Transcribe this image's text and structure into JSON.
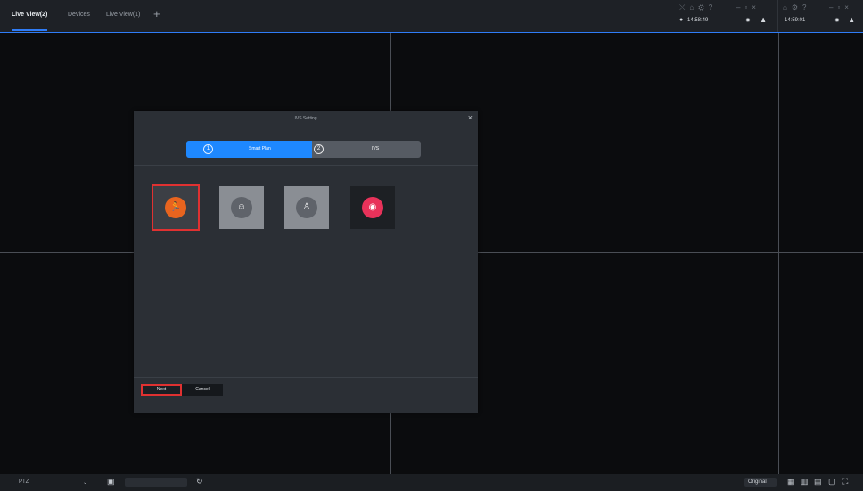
{
  "tabs": [
    {
      "label": "Live View(2)",
      "active": true
    },
    {
      "label": "Devices",
      "active": false
    },
    {
      "label": "Live View(1)",
      "active": false
    }
  ],
  "add_tab_icon": "plus-icon",
  "status": {
    "clock1": "14:58:49",
    "clock2": "14:59:01"
  },
  "dialog": {
    "title": "IVS Setting",
    "steps": [
      {
        "number": "1",
        "label": "Smart Plan"
      },
      {
        "number": "2",
        "label": "IVS"
      }
    ],
    "plans": [
      {
        "icon": "intrusion-person-icon",
        "color": "#e8641f",
        "selected": true
      },
      {
        "icon": "face-detection-icon",
        "color": "#7a7e84",
        "selected": false
      },
      {
        "icon": "people-counting-icon",
        "color": "#7a7e84",
        "selected": false
      },
      {
        "icon": "heat-map-icon",
        "color": "#e8325a",
        "selected": false
      }
    ],
    "next_label": "Next",
    "cancel_label": "Cancel"
  },
  "bottom": {
    "ptz_label": "PTZ",
    "stream_option": "Original"
  },
  "colors": {
    "accent": "#1e88ff",
    "selection": "#e03131"
  }
}
